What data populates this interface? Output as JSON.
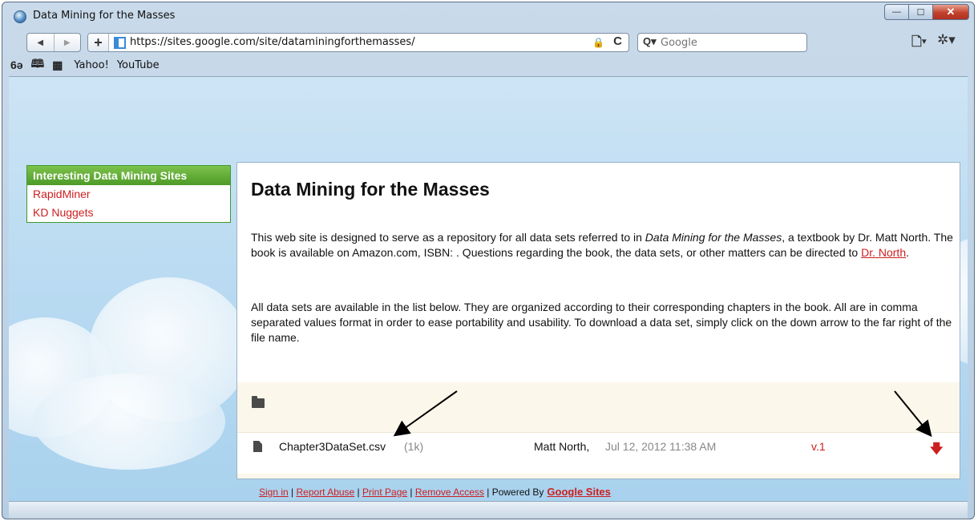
{
  "window": {
    "title": "Data Mining for the Masses",
    "minimize_glyph": "—",
    "maximize_glyph": "☐",
    "close_glyph": "✕"
  },
  "toolbar": {
    "back_glyph": "◀",
    "forward_glyph": "▶",
    "plus_glyph": "+",
    "url": "https://sites.google.com/site/dataminingforthemasses/",
    "lock_glyph": "🔒",
    "reload_glyph": "C",
    "search_icon_glyph": "Q▾",
    "search_placeholder": "Google",
    "page_menu_glyph": "🗋▾",
    "settings_menu_glyph": "✲▾"
  },
  "bookmarks": {
    "reader_glyph": "6ə",
    "book_glyph": "🕮",
    "grid_glyph": "▦",
    "links": [
      "Yahoo!",
      "YouTube"
    ]
  },
  "sidebar": {
    "title": "Interesting Data Mining Sites",
    "links": [
      "RapidMiner",
      "KD Nuggets"
    ]
  },
  "main": {
    "title": "Data Mining for the Masses",
    "para1_a": "This web site is designed to serve as a repository for all data sets referred to in ",
    "para1_italic": "Data Mining for the Masses",
    "para1_b": ", a textbook by Dr. Matt North.  The book is available on Amazon.com, ISBN: .  Questions regarding the book, the data sets, or other matters can be directed to ",
    "para1_link": "Dr. North",
    "para1_c": ".",
    "para2": "All data sets are available in the list below.  They are organized according to their corresponding chapters in the book.  All are in comma separated values format in order to ease portability and usability.  To download a data set, simply click on the down arrow to the far right of the file name."
  },
  "file": {
    "name": "Chapter3DataSet.csv",
    "size": "(1k)",
    "author": "Matt North,",
    "date": "Jul 12, 2012 11:38 AM",
    "version": "v.1",
    "download_glyph": "🡇"
  },
  "footer": {
    "sign_in": "Sign in",
    "report_abuse": "Report Abuse",
    "print_page": "Print Page",
    "remove_access": "Remove Access",
    "separator": " | ",
    "powered_by": "Powered By",
    "google_sites": "Google Sites"
  }
}
